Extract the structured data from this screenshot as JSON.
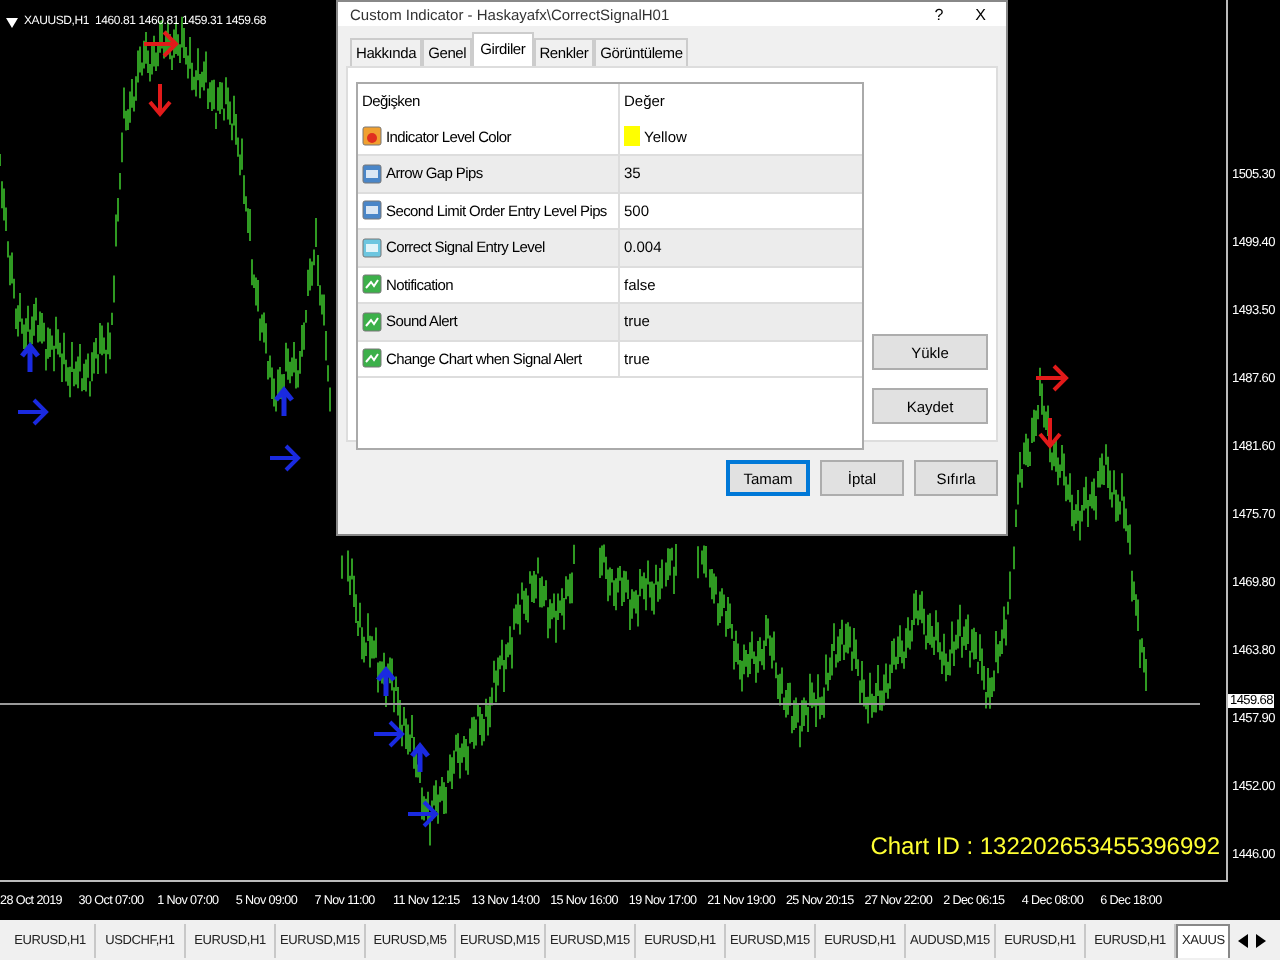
{
  "chart": {
    "header": "XAUUSD,H1  1460.81 1460.81 1459.31 1459.68",
    "price_ticks": [
      "1505.30",
      "1499.40",
      "1493.50",
      "1487.60",
      "1481.60",
      "1475.70",
      "1469.80",
      "1463.80",
      "1457.90",
      "1452.00",
      "1446.00"
    ],
    "current_price": "1459.68",
    "time_ticks": [
      "28 Oct 2019",
      "30 Oct 07:00",
      "1 Nov 07:00",
      "5 Nov 09:00",
      "7 Nov 11:00",
      "11 Nov 12:15",
      "13 Nov 14:00",
      "15 Nov 16:00",
      "19 Nov 17:00",
      "21 Nov 19:00",
      "25 Nov 20:15",
      "27 Nov 22:00",
      "2 Dec 06:15",
      "4 Dec 08:00",
      "6 Dec 18:00"
    ],
    "chart_id": "Chart ID : 132202653455396992"
  },
  "dialog": {
    "title": "Custom Indicator - Haskayafx\\CorrectSignalH01",
    "help": "?",
    "close": "X",
    "tabs": [
      {
        "label": "Hakkında",
        "selected": false
      },
      {
        "label": "Genel",
        "selected": false
      },
      {
        "label": "Girdiler",
        "selected": true
      },
      {
        "label": "Renkler",
        "selected": false
      },
      {
        "label": "Görüntüleme",
        "selected": false
      }
    ],
    "columns": [
      "Değişken",
      "Değer"
    ],
    "rows": [
      {
        "kind": "color",
        "name": "Indicator Level Color",
        "value": "Yellow",
        "color": "#ffff00"
      },
      {
        "kind": "int",
        "name": "Arrow Gap Pips",
        "value": "35"
      },
      {
        "kind": "int",
        "name": "Second Limit Order Entry Level Pips",
        "value": "500"
      },
      {
        "kind": "double",
        "name": "Correct Signal Entry Level",
        "value": "0.004"
      },
      {
        "kind": "bool",
        "name": "Notification",
        "value": "false"
      },
      {
        "kind": "bool",
        "name": "Sound Alert",
        "value": "true"
      },
      {
        "kind": "bool",
        "name": "Change Chart when Signal Alert",
        "value": "true"
      }
    ],
    "side_buttons": [
      "Yükle",
      "Kaydet"
    ],
    "buttons": [
      {
        "label": "Tamam",
        "default": true
      },
      {
        "label": "İptal",
        "default": false
      },
      {
        "label": "Sıfırla",
        "default": false
      }
    ]
  },
  "symbol_tabs": [
    {
      "label": "EURUSD,H1",
      "selected": false
    },
    {
      "label": "USDCHF,H1",
      "selected": false
    },
    {
      "label": "EURUSD,H1",
      "selected": false
    },
    {
      "label": "EURUSD,M15",
      "selected": false
    },
    {
      "label": "EURUSD,M5",
      "selected": false
    },
    {
      "label": "EURUSD,M15",
      "selected": false
    },
    {
      "label": "EURUSD,M15",
      "selected": false
    },
    {
      "label": "EURUSD,H1",
      "selected": false
    },
    {
      "label": "EURUSD,M15",
      "selected": false
    },
    {
      "label": "EURUSD,H1",
      "selected": false
    },
    {
      "label": "AUDUSD,M15",
      "selected": false
    },
    {
      "label": "EURUSD,H1",
      "selected": false
    },
    {
      "label": "EURUSD,H1",
      "selected": false
    },
    {
      "label": "XAUUS",
      "selected": true
    }
  ]
}
